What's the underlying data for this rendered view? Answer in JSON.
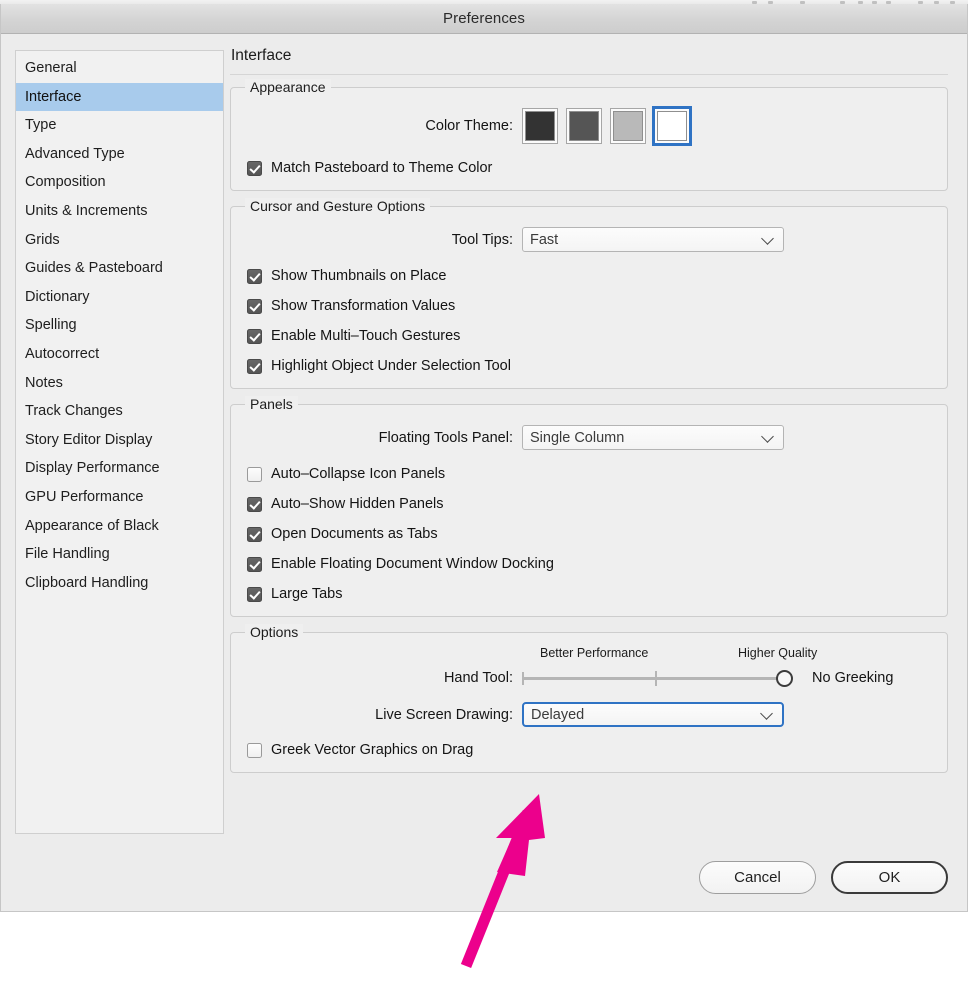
{
  "window": {
    "title": "Preferences"
  },
  "sidebar": {
    "items": [
      {
        "label": "General",
        "selected": false
      },
      {
        "label": "Interface",
        "selected": true
      },
      {
        "label": "Type",
        "selected": false
      },
      {
        "label": "Advanced Type",
        "selected": false
      },
      {
        "label": "Composition",
        "selected": false
      },
      {
        "label": "Units & Increments",
        "selected": false
      },
      {
        "label": "Grids",
        "selected": false
      },
      {
        "label": "Guides & Pasteboard",
        "selected": false
      },
      {
        "label": "Dictionary",
        "selected": false
      },
      {
        "label": "Spelling",
        "selected": false
      },
      {
        "label": "Autocorrect",
        "selected": false
      },
      {
        "label": "Notes",
        "selected": false
      },
      {
        "label": "Track Changes",
        "selected": false
      },
      {
        "label": "Story Editor Display",
        "selected": false
      },
      {
        "label": "Display Performance",
        "selected": false
      },
      {
        "label": "GPU Performance",
        "selected": false
      },
      {
        "label": "Appearance of Black",
        "selected": false
      },
      {
        "label": "File Handling",
        "selected": false
      },
      {
        "label": "Clipboard Handling",
        "selected": false
      }
    ]
  },
  "pane": {
    "title": "Interface"
  },
  "appearance": {
    "legend": "Appearance",
    "color_theme_label": "Color Theme:",
    "swatches": [
      {
        "name": "dark",
        "color": "#333333",
        "selected": false
      },
      {
        "name": "medium-dark",
        "color": "#555555",
        "selected": false
      },
      {
        "name": "light",
        "color": "#b9b9b9",
        "selected": false
      },
      {
        "name": "lightest",
        "color": "#ffffff",
        "selected": true
      }
    ],
    "match_pasteboard": {
      "label": "Match Pasteboard to Theme Color",
      "checked": true
    }
  },
  "cursor": {
    "legend": "Cursor and Gesture Options",
    "tool_tips_label": "Tool Tips:",
    "tool_tips_value": "Fast",
    "checkboxes": [
      {
        "label": "Show Thumbnails on Place",
        "checked": true
      },
      {
        "label": "Show Transformation Values",
        "checked": true
      },
      {
        "label": "Enable Multi–Touch Gestures",
        "checked": true
      },
      {
        "label": "Highlight Object Under Selection Tool",
        "checked": true
      }
    ]
  },
  "panels": {
    "legend": "Panels",
    "floating_tools_label": "Floating Tools Panel:",
    "floating_tools_value": "Single Column",
    "checkboxes": [
      {
        "label": "Auto–Collapse Icon Panels",
        "checked": false
      },
      {
        "label": "Auto–Show Hidden Panels",
        "checked": true
      },
      {
        "label": "Open Documents as Tabs",
        "checked": true
      },
      {
        "label": "Enable Floating Document Window Docking",
        "checked": true
      },
      {
        "label": "Large Tabs",
        "checked": true
      }
    ]
  },
  "options": {
    "legend": "Options",
    "slider_left_label": "Better Performance",
    "slider_right_label": "Higher Quality",
    "hand_tool_label": "Hand Tool:",
    "hand_tool_value": "No Greeking",
    "live_screen_drawing_label": "Live Screen Drawing:",
    "live_screen_drawing_value": "Delayed",
    "greek_vector": {
      "label": "Greek Vector Graphics on Drag",
      "checked": false
    }
  },
  "footer": {
    "cancel_label": "Cancel",
    "ok_label": "OK"
  },
  "annotation": {
    "arrow_color": "#ec008c",
    "points_to": "live-screen-drawing-select"
  }
}
